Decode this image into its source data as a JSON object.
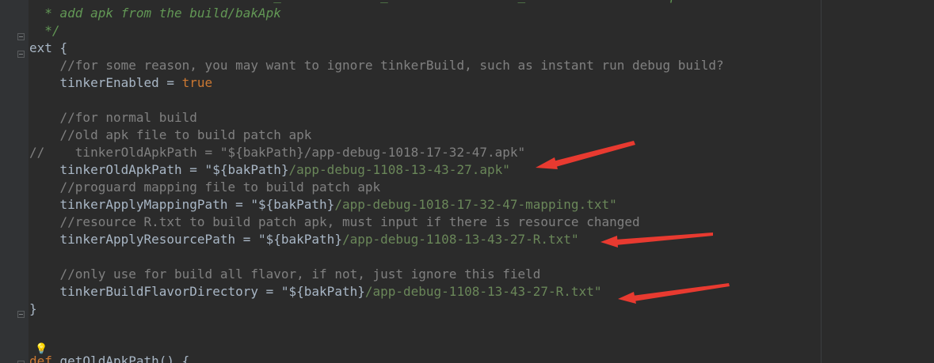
{
  "editor": {
    "lines": [
      {
        "parts": [
          {
            "cls": "doccomment",
            "bind": "l0a"
          }
        ]
      },
      {
        "parts": [
          {
            "cls": "doccomment",
            "bind": "l1a"
          }
        ]
      },
      {
        "parts": [
          {
            "cls": "doccomment",
            "bind": "l2a"
          }
        ]
      },
      {
        "parts": [
          {
            "cls": "",
            "bind": "l3a"
          }
        ]
      },
      {
        "parts": [
          {
            "cls": "comment",
            "bind": "l4a"
          }
        ]
      },
      {
        "parts": [
          {
            "cls": "",
            "bind": "l5a"
          },
          {
            "cls": "kw",
            "bind": "l5b"
          }
        ]
      },
      {
        "parts": [
          {
            "cls": "",
            "bind": "l6a"
          }
        ]
      },
      {
        "parts": [
          {
            "cls": "comment",
            "bind": "l7a"
          }
        ]
      },
      {
        "parts": [
          {
            "cls": "comment",
            "bind": "l8a"
          }
        ]
      },
      {
        "parts": [
          {
            "cls": "comment",
            "bind": "l9a"
          }
        ]
      },
      {
        "parts": [
          {
            "cls": "",
            "bind": "l10a"
          },
          {
            "cls": "str",
            "bind": "l10b"
          }
        ]
      },
      {
        "parts": [
          {
            "cls": "comment",
            "bind": "l11a"
          }
        ]
      },
      {
        "parts": [
          {
            "cls": "",
            "bind": "l12a"
          },
          {
            "cls": "str",
            "bind": "l12b"
          }
        ]
      },
      {
        "parts": [
          {
            "cls": "comment",
            "bind": "l13a"
          }
        ]
      },
      {
        "parts": [
          {
            "cls": "",
            "bind": "l14a"
          },
          {
            "cls": "str",
            "bind": "l14b"
          }
        ]
      },
      {
        "parts": [
          {
            "cls": "",
            "bind": "l15a"
          }
        ]
      },
      {
        "parts": [
          {
            "cls": "comment",
            "bind": "l16a"
          }
        ]
      },
      {
        "parts": [
          {
            "cls": "",
            "bind": "l17a"
          },
          {
            "cls": "str",
            "bind": "l17b"
          }
        ]
      },
      {
        "parts": [
          {
            "cls": "",
            "bind": "l18a"
          }
        ]
      },
      {
        "parts": [
          {
            "cls": "",
            "bind": "l19a"
          }
        ]
      },
      {
        "parts": [
          {
            "cls": "",
            "bind": "l20a"
          }
        ]
      },
      {
        "parts": [
          {
            "cls": "kw",
            "bind": "l21a"
          },
          {
            "cls": "fn",
            "bind": "l21b"
          }
        ]
      }
    ],
    "text": {
      "l0a": "  * use tinkerPatchRelease -POLD_APK=  -PAPPLY_MAPPING=  -PAPPLY_RESOURCE= to build patch",
      "l1a": "  * add apk from the build/bakApk",
      "l2a": "  */",
      "l3a": "ext {",
      "l4a": "    //for some reason, you may want to ignore tinkerBuild, such as instant run debug build?",
      "l5a": "    tinkerEnabled = ",
      "l5b": "true",
      "l6a": " ",
      "l7a": "    //for normal build",
      "l8a": "    //old apk file to build patch apk",
      "l9a": "//    tinkerOldApkPath = \"${bakPath}/app-debug-1018-17-32-47.apk\"",
      "l10a": "    tinkerOldApkPath = \"${bakPath}",
      "l10b": "/app-debug-1108-13-43-27.apk\"",
      "l11a": "    //proguard mapping file to build patch apk",
      "l12a": "    tinkerApplyMappingPath = \"${bakPath}",
      "l12b": "/app-debug-1018-17-32-47-mapping.txt\"",
      "l13a": "    //resource R.txt to build patch apk, must input if there is resource changed",
      "l14a": "    tinkerApplyResourcePath = \"${bakPath}",
      "l14b": "/app-debug-1108-13-43-27-R.txt\"",
      "l15a": " ",
      "l16a": "    //only use for build all flavor, if not, just ignore this field",
      "l17a": "    tinkerBuildFlavorDirectory = \"${bakPath}",
      "l17b": "/app-debug-1108-13-43-27-R.txt\"",
      "l18a": "}",
      "l19a": " ",
      "l20a": " ",
      "l21a": "def ",
      "l21b": "getOldApkPath() {"
    }
  },
  "icons": {
    "bulb": "lightbulb-icon",
    "arrows": "red-arrow-annotation"
  },
  "colors": {
    "background": "#2b2b2b",
    "comment": "#808080",
    "keyword": "#cc7832",
    "string": "#6a8759",
    "arrow": "#e83a30"
  }
}
